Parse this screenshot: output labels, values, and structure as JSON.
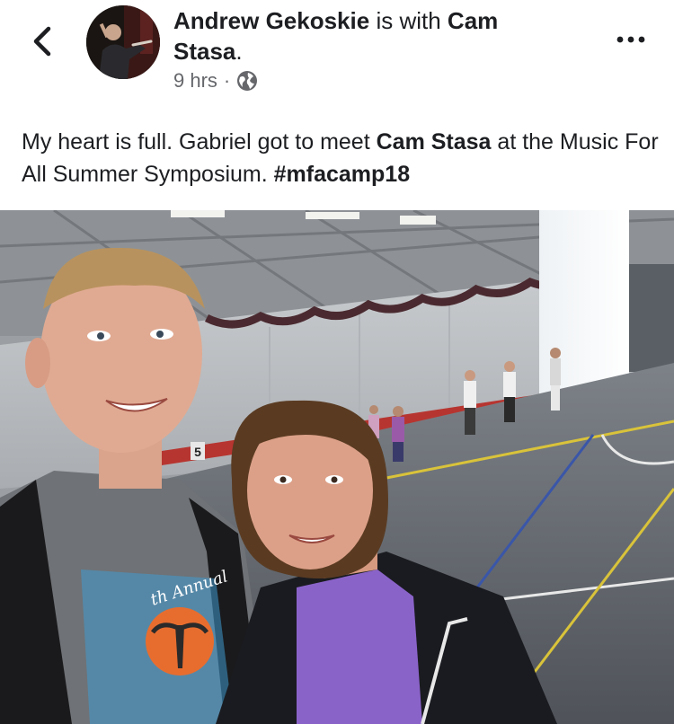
{
  "post": {
    "author": "Andrew Gekoskie",
    "with_text": "is with",
    "tagged": "Cam Stasa",
    "timestamp": "9 hrs",
    "separator": "·",
    "privacy_icon": "globe-icon",
    "text_part1": "My heart is full. Gabriel got to meet ",
    "text_mention": "Cam Stasa",
    "text_part2": " at the Music For All Summer Symposium. ",
    "hashtag": "#mfacamp18"
  },
  "photo": {
    "shirt_text": "th Annual",
    "court_number": "5"
  },
  "icons": {
    "back": "chevron-left-icon",
    "more": "more-horizontal-icon"
  },
  "colors": {
    "text_primary": "#1c1e21",
    "text_secondary": "#65676b",
    "wall_stripe": "#b73530",
    "court_line": "#d9c33a"
  }
}
